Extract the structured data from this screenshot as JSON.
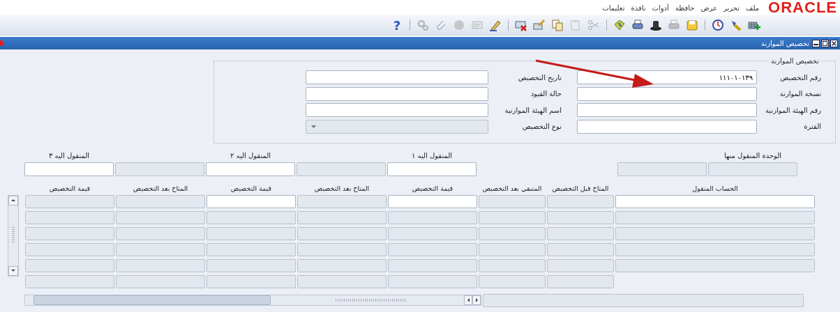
{
  "brand": {
    "logo": "ORACLE"
  },
  "menu_bar": {
    "items": [
      "ملف",
      "تحرير",
      "عرض",
      "حافظة",
      "أدوات",
      "نافذة",
      "تعليمات"
    ]
  },
  "toolbar": {
    "buttons": [
      {
        "kind": "new-record",
        "disabled": false
      },
      {
        "kind": "flashlight",
        "disabled": false
      },
      {
        "kind": "clock",
        "disabled": false
      },
      {
        "kind": "separator"
      },
      {
        "kind": "save",
        "disabled": false
      },
      {
        "kind": "print-preview",
        "disabled": true
      },
      {
        "kind": "hat",
        "disabled": false
      },
      {
        "kind": "printer",
        "disabled": false
      },
      {
        "kind": "tag",
        "disabled": false
      },
      {
        "kind": "separator"
      },
      {
        "kind": "scissors",
        "disabled": true
      },
      {
        "kind": "paste",
        "disabled": true
      },
      {
        "kind": "copy",
        "disabled": false
      },
      {
        "kind": "edit-card",
        "disabled": false
      },
      {
        "kind": "delete-record",
        "disabled": false
      },
      {
        "kind": "separator"
      },
      {
        "kind": "pen",
        "disabled": false
      },
      {
        "kind": "card",
        "disabled": true
      },
      {
        "kind": "circle",
        "disabled": true
      },
      {
        "kind": "paperclip",
        "disabled": true
      },
      {
        "kind": "gears",
        "disabled": true
      },
      {
        "kind": "separator"
      },
      {
        "kind": "help",
        "glyph": "?"
      }
    ]
  },
  "window": {
    "title": "تخصيص الموازنة"
  },
  "header_group": {
    "title": "تخصيص الموازنة",
    "fields": [
      {
        "label": "رقم التخصيص",
        "value": "١١١٠١٠١٣٩",
        "kind": "text",
        "disabled": false
      },
      {
        "label": "تاريخ التخصيص",
        "kind": "text",
        "disabled": false
      },
      {
        "label": "نسخة الموازنة",
        "kind": "text",
        "disabled": false
      },
      {
        "label": "حالة القيود",
        "kind": "text",
        "disabled": false
      },
      {
        "label": "رقم الهيئة الموازنية",
        "kind": "text",
        "disabled": false
      },
      {
        "label": "اسم الهيئة الموازنية",
        "kind": "text",
        "disabled": false
      },
      {
        "label": "الفترة",
        "kind": "text",
        "disabled": false
      },
      {
        "label": "نوع التخصيص",
        "kind": "dropdown",
        "disabled": true
      }
    ]
  },
  "transfer_groups": [
    {
      "label": "الوحدة المنقول منها",
      "fields": [
        {
          "disabled": true
        },
        {
          "disabled": true
        }
      ]
    },
    {
      "label": "المنقول اليه ١",
      "fields": [
        {
          "disabled": false
        },
        {
          "disabled": true
        }
      ]
    },
    {
      "label": "المنقول اليه ٢",
      "fields": [
        {
          "disabled": false
        },
        {
          "disabled": true
        }
      ]
    },
    {
      "label": "المنقول اليه ٣",
      "fields": [
        {
          "disabled": false
        }
      ]
    }
  ],
  "table": {
    "columns": [
      {
        "header": "الحساب المنقول",
        "enterable": true,
        "has_total": false
      },
      {
        "header": "المتاح قبل التخصيص",
        "enterable": false,
        "has_total": true
      },
      {
        "header": "المتبقي بعد التخصيص",
        "enterable": false,
        "has_total": true
      },
      {
        "header": "قيمة التخصيص",
        "enterable": true,
        "has_total": true
      },
      {
        "header": "المتاح بعد التخصيص",
        "enterable": false,
        "has_total": true
      },
      {
        "header": "قيمة التخصيص",
        "enterable": true,
        "has_total": true
      },
      {
        "header": "المتاح بعد التخصيص",
        "enterable": false,
        "has_total": true
      },
      {
        "header": "قيمة التخصيص",
        "enterable": false,
        "has_total": true
      }
    ],
    "rows": [
      {
        "current": true
      },
      {
        "current": false
      },
      {
        "current": false
      },
      {
        "current": false
      },
      {
        "current": false
      }
    ]
  },
  "footer_field": {
    "disabled": true
  }
}
